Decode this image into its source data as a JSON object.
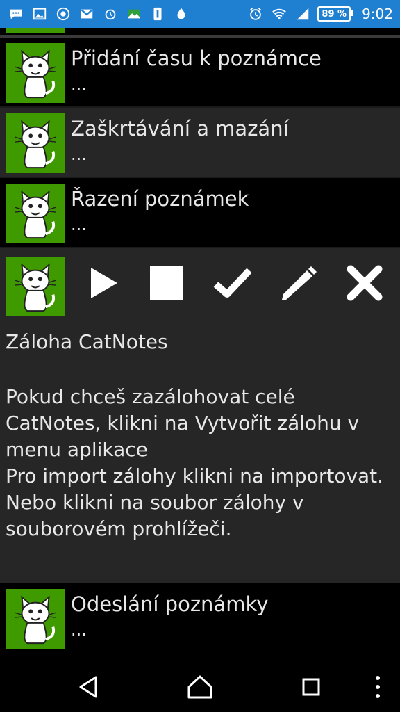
{
  "status_bar": {
    "battery_percent": "89 %",
    "time": "9:02",
    "icons": [
      "chat-icon",
      "image-icon",
      "lego-icon",
      "gmail-icon",
      "alarm-robot-icon",
      "landscape-icon",
      "sim-icon",
      "drop-icon",
      "alarm-icon",
      "wifi-icon",
      "signal-icon"
    ]
  },
  "notes": [
    {
      "title": "Přidání času k poznámce",
      "subtitle": "..."
    },
    {
      "title": "Zaškrtávání a mazání",
      "subtitle": "..."
    },
    {
      "title": "Řazení poznámek",
      "subtitle": "..."
    }
  ],
  "expanded": {
    "title": "Záloha CatNotes",
    "body": "  Pokud chceš zazálohovat celé CatNotes, klikni na Vytvořit zálohu v menu aplikace\n  Pro import zálohy klikni na importovat. Nebo klikni na soubor zálohy v souborovém prohlížeči.",
    "actions": [
      "play-icon",
      "stop-icon",
      "check-icon",
      "pencil-icon",
      "close-icon"
    ]
  },
  "last_note": {
    "title": "Odeslání poznámky",
    "subtitle": "..."
  },
  "colors": {
    "accent_green": "#3f9a00",
    "status_bar_blue": "#1f7fd0",
    "row_grey": "#262626"
  }
}
